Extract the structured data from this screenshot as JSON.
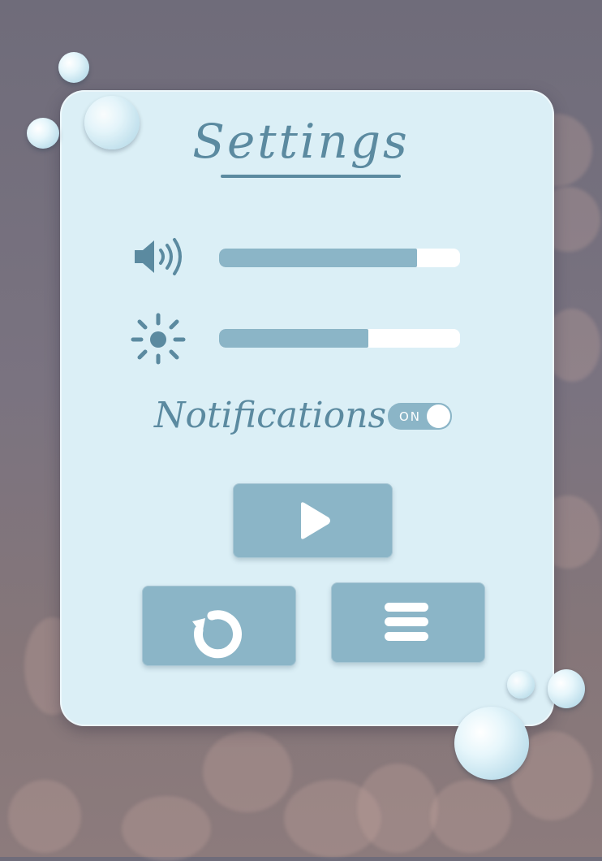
{
  "title": "Settings",
  "sliders": [
    {
      "name": "volume",
      "icon": "speaker-icon",
      "level": 0.82
    },
    {
      "name": "brightness",
      "icon": "sun-icon",
      "level": 0.62
    }
  ],
  "notifications": {
    "label": "Notifications",
    "toggle_text": "ON",
    "enabled": true
  },
  "buttons": {
    "play": "play-icon",
    "restart": "restart-icon",
    "menu": "menu-icon"
  },
  "colors": {
    "panel": "#dbeff6",
    "accent": "#5b8aa0",
    "button": "#8bb5c7",
    "fill": "#8bb5c7",
    "track": "#ffffff"
  }
}
